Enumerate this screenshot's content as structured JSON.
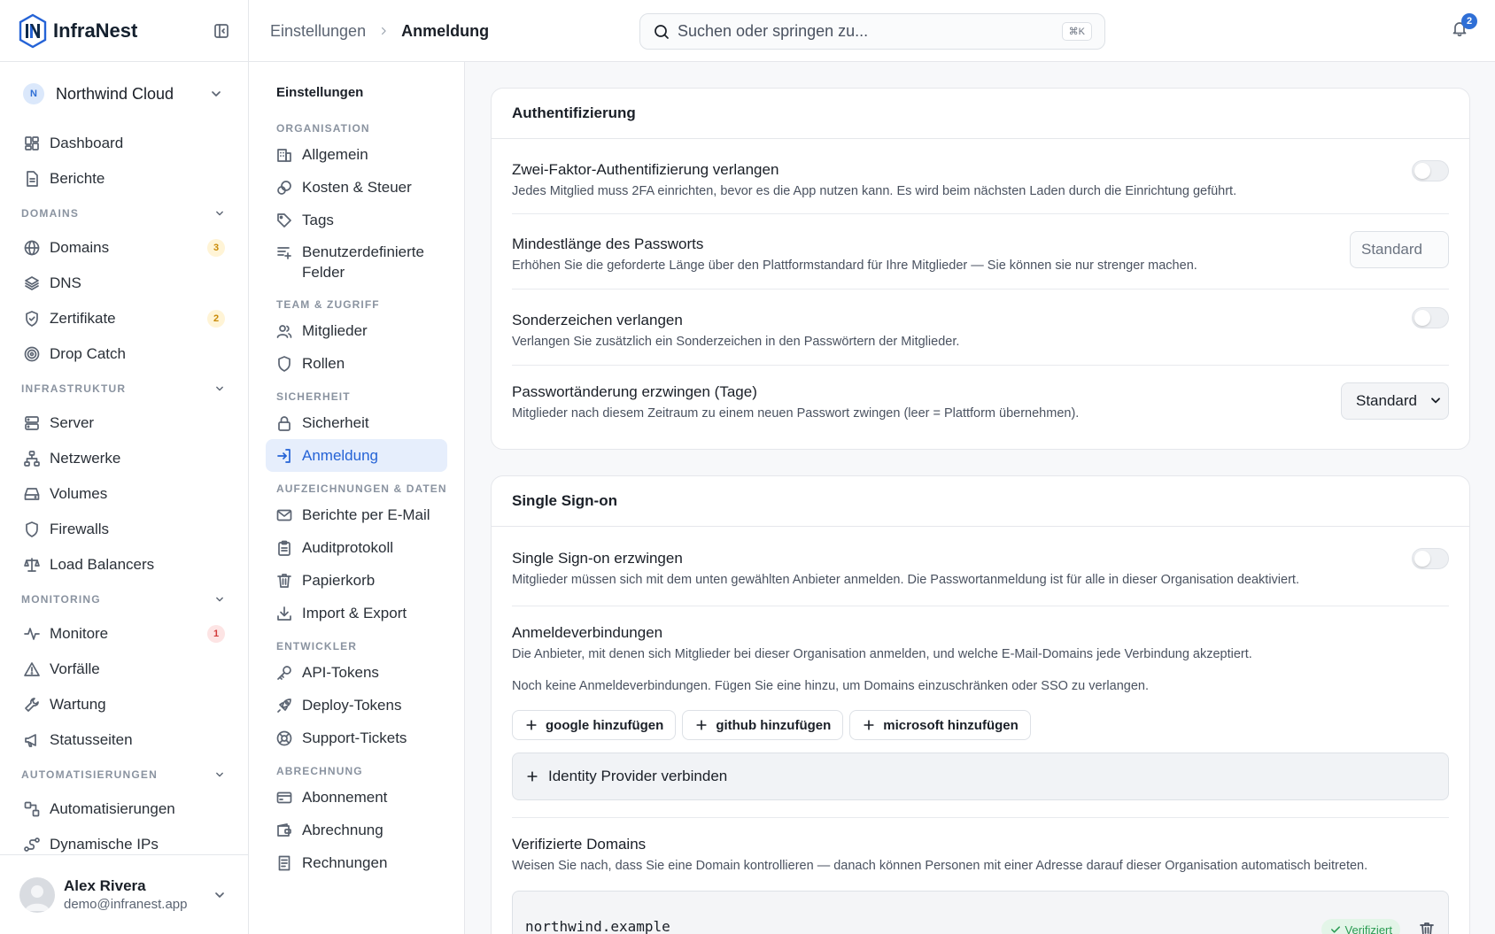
{
  "app": {
    "name": "InfraNest"
  },
  "sidebar": {
    "org_initial": "N",
    "org_name": "Northwind Cloud",
    "top_items": [
      {
        "label": "Dashboard",
        "icon": "dashboard-icon"
      },
      {
        "label": "Berichte",
        "icon": "document-icon"
      }
    ],
    "sections": [
      {
        "title": "DOMAINS",
        "items": [
          {
            "label": "Domains",
            "icon": "globe-icon",
            "badge": "3",
            "badge_color": "amber"
          },
          {
            "label": "DNS",
            "icon": "layers-icon"
          },
          {
            "label": "Zertifikate",
            "icon": "shield-check-icon",
            "badge": "2",
            "badge_color": "amber"
          },
          {
            "label": "Drop Catch",
            "icon": "target-icon"
          }
        ]
      },
      {
        "title": "INFRASTRUKTUR",
        "items": [
          {
            "label": "Server",
            "icon": "server-icon"
          },
          {
            "label": "Netzwerke",
            "icon": "network-icon"
          },
          {
            "label": "Volumes",
            "icon": "drive-icon"
          },
          {
            "label": "Firewalls",
            "icon": "shield-icon"
          },
          {
            "label": "Load Balancers",
            "icon": "scale-icon"
          }
        ]
      },
      {
        "title": "MONITORING",
        "items": [
          {
            "label": "Monitore",
            "icon": "pulse-icon",
            "badge": "1",
            "badge_color": "red"
          },
          {
            "label": "Vorfälle",
            "icon": "warning-icon"
          },
          {
            "label": "Wartung",
            "icon": "wrench-icon"
          },
          {
            "label": "Statusseiten",
            "icon": "megaphone-icon"
          }
        ]
      },
      {
        "title": "AUTOMATISIERUNGEN",
        "items": [
          {
            "label": "Automatisierungen",
            "icon": "workflow-icon"
          },
          {
            "label": "Dynamische IPs",
            "icon": "dynamic-ip-icon"
          }
        ]
      }
    ],
    "user": {
      "name": "Alex Rivera",
      "email": "demo@infranest.app"
    }
  },
  "topbar": {
    "breadcrumb": [
      "Einstellungen",
      "Anmeldung"
    ],
    "search_placeholder": "Suchen oder springen zu...",
    "search_shortcut": "⌘K",
    "notifications": "2"
  },
  "settings_nav": {
    "title": "Einstellungen",
    "sections": [
      {
        "title": "ORGANISATION",
        "items": [
          {
            "label": "Allgemein",
            "icon": "building-icon"
          },
          {
            "label": "Kosten & Steuer",
            "icon": "coins-icon"
          },
          {
            "label": "Tags",
            "icon": "tag-icon"
          },
          {
            "label": "Benutzerdefinierte Felder",
            "icon": "custom-fields-icon"
          }
        ]
      },
      {
        "title": "TEAM & ZUGRIFF",
        "items": [
          {
            "label": "Mitglieder",
            "icon": "users-icon"
          },
          {
            "label": "Rollen",
            "icon": "shield-icon"
          }
        ]
      },
      {
        "title": "SICHERHEIT",
        "items": [
          {
            "label": "Sicherheit",
            "icon": "lock-icon"
          },
          {
            "label": "Anmeldung",
            "icon": "login-icon",
            "active": true
          }
        ]
      },
      {
        "title": "AUFZEICHNUNGEN & DATEN",
        "items": [
          {
            "label": "Berichte per E-Mail",
            "icon": "mail-icon"
          },
          {
            "label": "Auditprotokoll",
            "icon": "clipboard-icon"
          },
          {
            "label": "Papierkorb",
            "icon": "trash-icon"
          },
          {
            "label": "Import & Export",
            "icon": "download-icon"
          }
        ]
      },
      {
        "title": "ENTWICKLER",
        "items": [
          {
            "label": "API-Tokens",
            "icon": "key-icon"
          },
          {
            "label": "Deploy-Tokens",
            "icon": "rocket-icon"
          },
          {
            "label": "Support-Tickets",
            "icon": "lifebuoy-icon"
          }
        ]
      },
      {
        "title": "ABRECHNUNG",
        "items": [
          {
            "label": "Abonnement",
            "icon": "credit-card-icon"
          },
          {
            "label": "Abrechnung",
            "icon": "wallet-icon"
          },
          {
            "label": "Rechnungen",
            "icon": "receipt-icon"
          }
        ]
      }
    ]
  },
  "auth_card": {
    "title": "Authentifizierung",
    "twofa": {
      "title": "Zwei-Faktor-Authentifizierung verlangen",
      "desc": "Jedes Mitglied muss 2FA einrichten, bevor es die App nutzen kann. Es wird beim nächsten Laden durch die Einrichtung geführt.",
      "enabled": false
    },
    "min_length": {
      "title": "Mindestlänge des Passworts",
      "desc": "Erhöhen Sie die geforderte Länge über den Plattformstandard für Ihre Mitglieder — Sie können sie nur strenger machen.",
      "placeholder": "Standard"
    },
    "special_chars": {
      "title": "Sonderzeichen verlangen",
      "desc": "Verlangen Sie zusätzlich ein Sonderzeichen in den Passwörtern der Mitglieder.",
      "enabled": false
    },
    "pw_change": {
      "title": "Passwortänderung erzwingen (Tage)",
      "desc": "Mitglieder nach diesem Zeitraum zu einem neuen Passwort zwingen (leer = Plattform übernehmen).",
      "value": "Standard"
    }
  },
  "sso_card": {
    "title": "Single Sign-on",
    "enforce": {
      "title": "Single Sign-on erzwingen",
      "desc": "Mitglieder müssen sich mit dem unten gewählten Anbieter anmelden. Die Passwortanmeldung ist für alle in dieser Organisation deaktiviert.",
      "enabled": false
    },
    "connections": {
      "title": "Anmeldeverbindungen",
      "desc": "Die Anbieter, mit denen sich Mitglieder bei dieser Organisation anmelden, und welche E-Mail-Domains jede Verbindung akzeptiert.",
      "empty": "Noch keine Anmeldeverbindungen. Fügen Sie eine hinzu, um Domains einzuschränken oder SSO zu verlangen.",
      "buttons": [
        "google hinzufügen",
        "github hinzufügen",
        "microsoft hinzufügen"
      ],
      "idp_button": "Identity Provider verbinden"
    },
    "domains": {
      "title": "Verifizierte Domains",
      "desc": "Weisen Sie nach, dass Sie eine Domain kontrollieren — danach können Personen mit einer Adresse darauf dieser Organisation automatisch beitreten.",
      "items": [
        {
          "name": "northwind.example",
          "status": "Verifiziert"
        }
      ]
    }
  }
}
